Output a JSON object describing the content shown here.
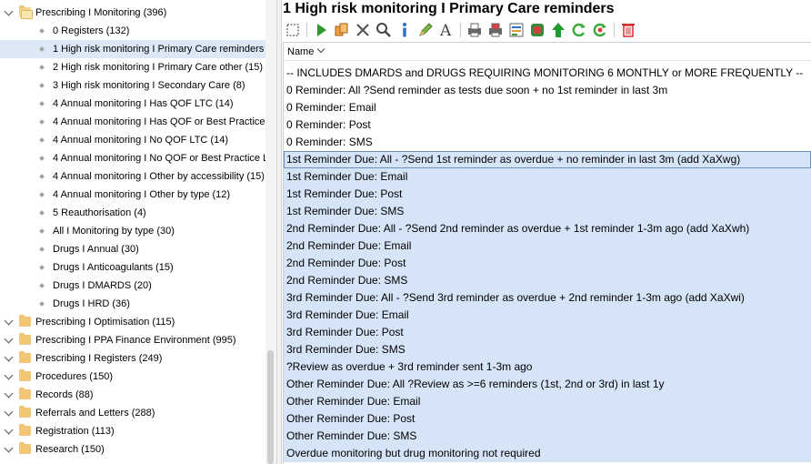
{
  "tree": {
    "top_node": "Prescribing I Monitoring (396)",
    "children": [
      "0 Registers (132)",
      "1 High risk monitoring I Primary Care reminders (2",
      "2 High risk monitoring I Primary Care other (15)",
      "3 High risk monitoring I Secondary Care (8)",
      "4 Annual monitoring I Has QOF LTC (14)",
      "4 Annual monitoring I Has QOF or Best Practice L",
      "4 Annual monitoring I No QOF LTC (14)",
      "4 Annual monitoring I No QOF or Best Practice LT",
      "4 Annual monitoring I Other by accessibility (15)",
      "4 Annual monitoring I Other by type (12)",
      "5 Reauthorisation (4)",
      "All I Monitoring by type (30)",
      "Drugs I Annual (30)",
      "Drugs I Anticoagulants (15)",
      "Drugs I DMARDS (20)",
      "Drugs I HRD (36)"
    ],
    "selected_index": 1,
    "folders": [
      "Prescribing I Optimisation (115)",
      "Prescribing I PPA Finance Environment (995)",
      "Prescribing I Registers (249)",
      "Procedures (150)",
      "Records (88)",
      "Referrals and Letters (288)",
      "Registration (113)",
      "Research (150)"
    ]
  },
  "panel": {
    "title": "1 High risk monitoring I Primary Care reminders",
    "toolbar": [
      {
        "icon": "select-box-icon"
      },
      {
        "sep": true
      },
      {
        "icon": "run-icon"
      },
      {
        "icon": "copy-icon"
      },
      {
        "icon": "delete-x-icon"
      },
      {
        "icon": "search-icon"
      },
      {
        "icon": "info-icon"
      },
      {
        "icon": "edit-pen-icon"
      },
      {
        "icon": "rename-a-icon"
      },
      {
        "sep": true
      },
      {
        "icon": "print-icon"
      },
      {
        "icon": "print-red-icon"
      },
      {
        "icon": "report-icon"
      },
      {
        "icon": "batch-icon"
      },
      {
        "icon": "up-arrow-icon"
      },
      {
        "icon": "refresh-icon"
      },
      {
        "icon": "refresh-red-icon"
      },
      {
        "sep": true
      },
      {
        "icon": "trash-icon"
      }
    ],
    "column_header": "Name",
    "rows": [
      "-- INCLUDES DMARDS and DRUGS REQUIRING MONITORING 6 MONTHLY or MORE FREQUENTLY --",
      "0 Reminder: All ?Send reminder as tests due soon + no 1st reminder in last 3m",
      "0 Reminder: Email",
      "0 Reminder: Post",
      "0 Reminder: SMS",
      "1st Reminder Due: All - ?Send 1st reminder as overdue + no reminder in last 3m (add XaXwg)",
      "1st Reminder Due: Email",
      "1st Reminder Due: Post",
      "1st Reminder Due: SMS",
      "2nd Reminder Due: All - ?Send 2nd reminder as overdue + 1st reminder 1-3m ago (add XaXwh)",
      "2nd Reminder Due: Email",
      "2nd Reminder Due: Post",
      "2nd Reminder Due: SMS",
      "3rd Reminder Due: All - ?Send 3rd reminder as overdue + 2nd reminder 1-3m ago (add XaXwi)",
      "3rd Reminder Due: Email",
      "3rd Reminder Due: Post",
      "3rd Reminder Due: SMS",
      "?Review as overdue + 3rd reminder sent 1-3m ago",
      "Other Reminder Due: All ?Review as >=6 reminders (1st, 2nd or 3rd) in last 1y",
      "Other Reminder Due: Email",
      "Other Reminder Due: Post",
      "Other Reminder Due: SMS",
      "Overdue monitoring but drug monitoring not required"
    ],
    "selected_from": 5,
    "focus_index": 5
  },
  "colors": {
    "selection": "#d5e4f7",
    "tree_selection": "#dde8f7",
    "folder": "#f1c776"
  }
}
